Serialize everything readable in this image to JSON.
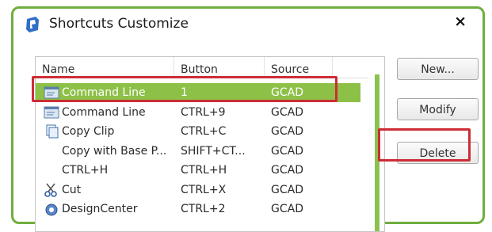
{
  "window": {
    "title": "Shortcuts Customize",
    "close_glyph": "×",
    "frame_color": "#6fae3f"
  },
  "list": {
    "columns": [
      "Name",
      "Button",
      "Source",
      ""
    ],
    "selection_color": "#8dc047",
    "rows": [
      {
        "icon": "command-line-icon",
        "name": "Command Line",
        "button": "1",
        "source": "GCAD",
        "selected": true
      },
      {
        "icon": "command-line-icon",
        "name": "Command Line",
        "button": "CTRL+9",
        "source": "GCAD",
        "selected": false
      },
      {
        "icon": "copy-clip-icon",
        "name": "Copy Clip",
        "button": "CTRL+C",
        "source": "GCAD",
        "selected": false
      },
      {
        "icon": "",
        "name": "Copy with Base P...",
        "button": "SHIFT+CT...",
        "source": "GCAD",
        "selected": false
      },
      {
        "icon": "",
        "name": "CTRL+H",
        "button": "CTRL+H",
        "source": "GCAD",
        "selected": false
      },
      {
        "icon": "scissors-icon",
        "name": "Cut",
        "button": "CTRL+X",
        "source": "GCAD",
        "selected": false
      },
      {
        "icon": "design-center-icon",
        "name": "DesignCenter",
        "button": "CTRL+2",
        "source": "GCAD",
        "selected": false
      }
    ]
  },
  "buttons": {
    "new_label": "New...",
    "modify_label": "Modify",
    "delete_label": "Delete"
  },
  "annotation": {
    "highlight_color": "#cc2d35"
  }
}
